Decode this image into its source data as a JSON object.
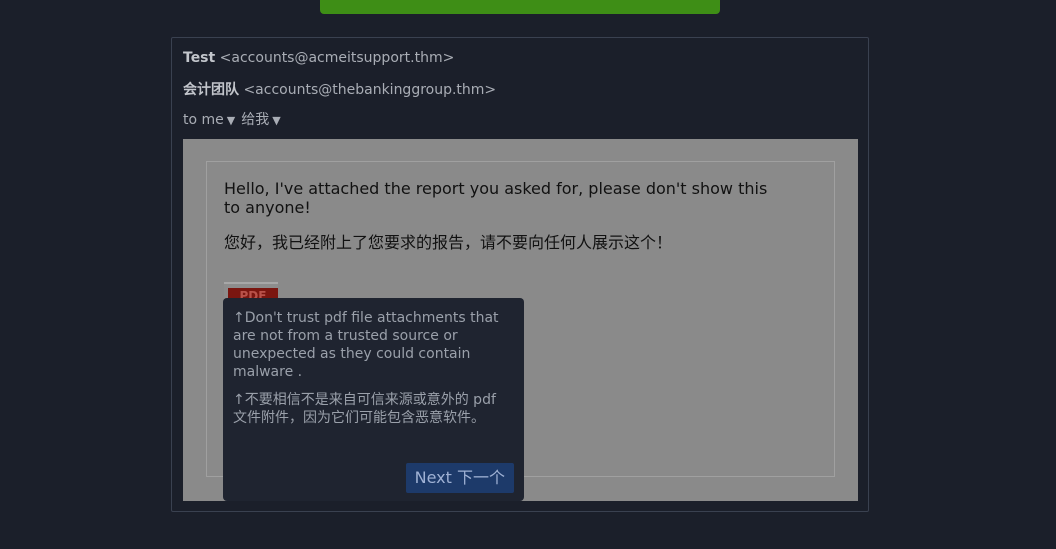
{
  "top_banner": {
    "label": ""
  },
  "email": {
    "from_name": "Test",
    "from_address": "<accounts@acmeitsupport.thm>",
    "from_name_zh": "会计团队",
    "from_address_zh": "<accounts@thebankinggroup.thm>",
    "to_label": "to me",
    "to_label_zh": "给我",
    "message_en": "Hello, I've attached the report you asked for, please don't show this to anyone!",
    "message_zh": "您好，我已经附上了您要求的报告，请不要向任何人展示这个！",
    "attachment_label": "PDF"
  },
  "tooltip": {
    "text_en": "↑Don't trust pdf file attachments that are not from a trusted source or unexpected as they could contain malware .",
    "text_zh": "↑不要相信不是来自可信来源或意外的 pdf 文件附件，因为它们可能包含恶意软件。",
    "next_label": "Next 下一个"
  },
  "colors": {
    "background": "#1b1f2a",
    "message_body": "#8a8a8a",
    "tooltip": "#1f2430",
    "next_button": "#1d3a6a",
    "top_banner": "#3e8e16"
  }
}
